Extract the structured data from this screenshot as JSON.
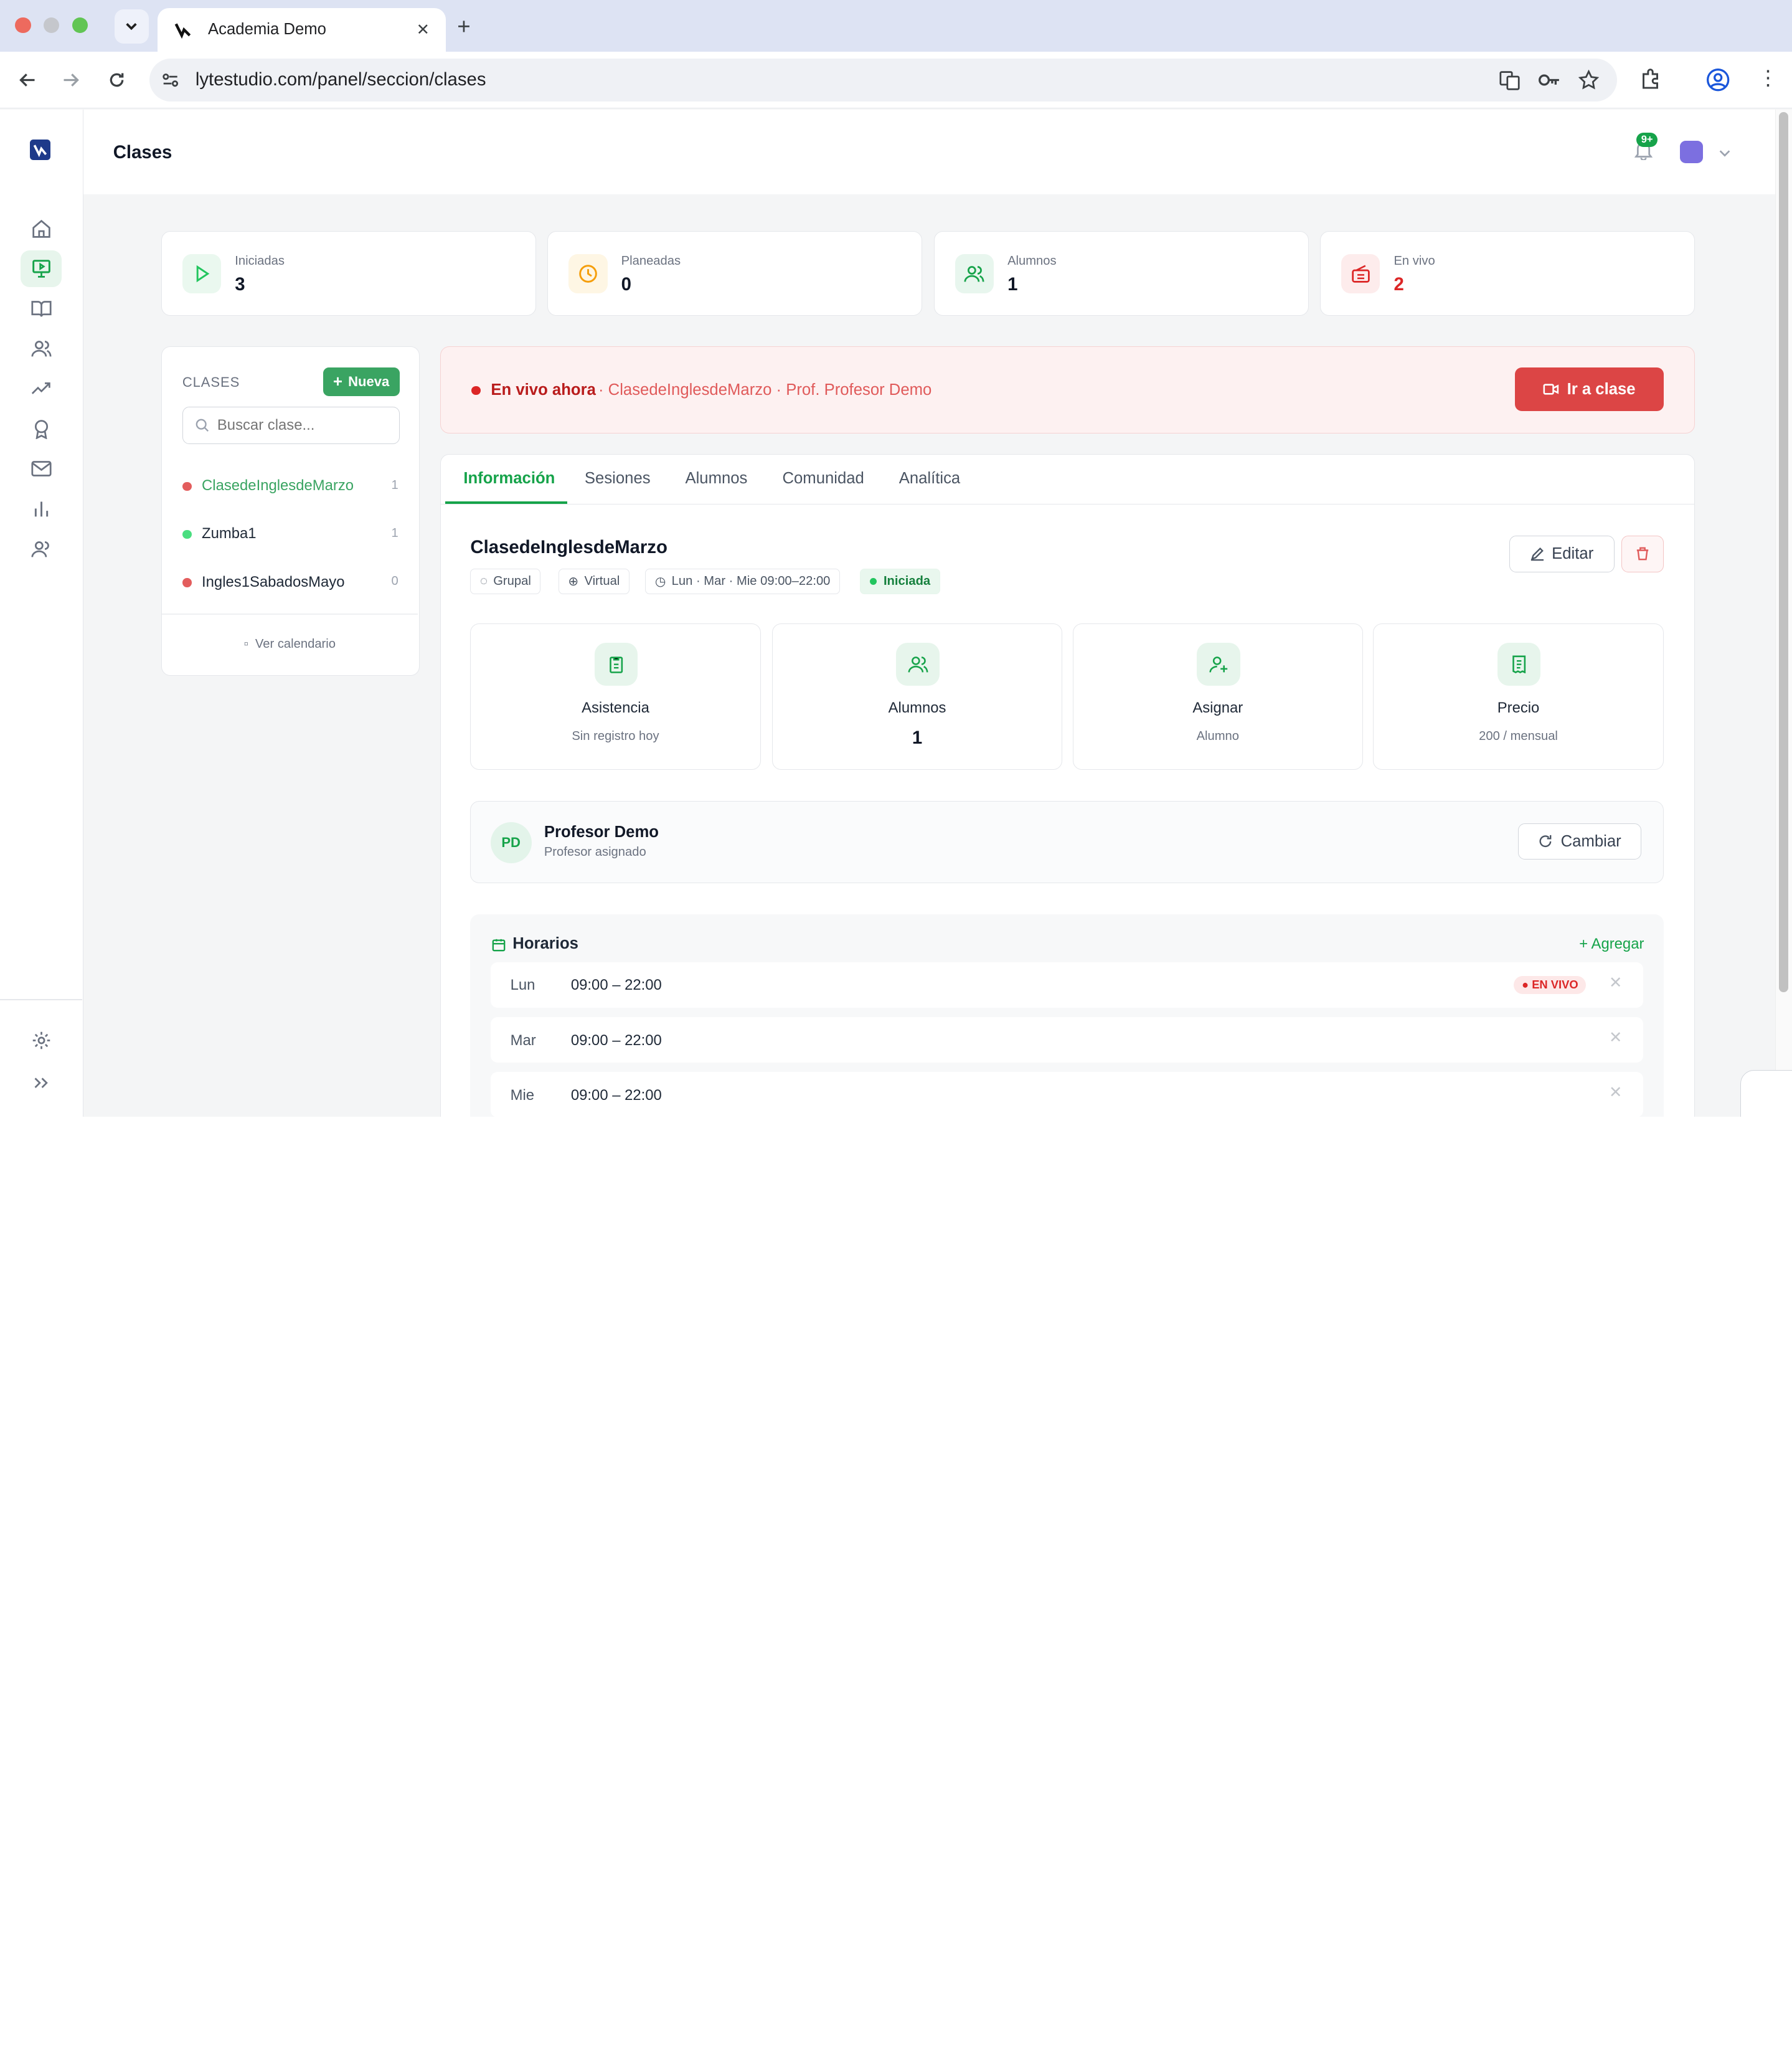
{
  "browser": {
    "tab_title": "Academia Demo",
    "url": "lytestudio.com/panel/seccion/clases"
  },
  "header": {
    "title": "Clases",
    "notif_badge": "9+"
  },
  "stats": [
    {
      "label": "Iniciadas",
      "value": "3",
      "icon": "play-icon",
      "color": "#22c55e"
    },
    {
      "label": "Planeadas",
      "value": "0",
      "icon": "clock-icon",
      "color": "#f59e0b"
    },
    {
      "label": "Alumnos",
      "value": "1",
      "icon": "users-icon",
      "color": "#16a34a"
    },
    {
      "label": "En vivo",
      "value": "2",
      "icon": "radio-icon",
      "color": "#dc2626"
    }
  ],
  "classes_panel": {
    "heading": "CLASES",
    "new_label": "Nueva",
    "search_placeholder": "Buscar clase...",
    "calendar_label": "Ver calendario",
    "items": [
      {
        "name": "ClasedeInglesdeMarzo",
        "count": "1",
        "dot": "#e35d5d"
      },
      {
        "name": "Zumba1",
        "count": "1",
        "dot": "#4ade80"
      },
      {
        "name": "Ingles1SabadosMayo",
        "count": "0",
        "dot": "#e35d5d"
      }
    ]
  },
  "live_banner": {
    "label": "En vivo ahora",
    "detail": "· ClasedeInglesdeMarzo · Prof. Profesor Demo",
    "button": "Ir a clase"
  },
  "tabs": [
    "Información",
    "Sesiones",
    "Alumnos",
    "Comunidad",
    "Analítica"
  ],
  "class_detail": {
    "title": "ClasedeInglesdeMarzo",
    "edit_label": "Editar",
    "chips": {
      "type": "Grupal",
      "mode": "Virtual",
      "schedule": "Lun · Mar · Mie 09:00–22:00",
      "status": "Iniciada"
    },
    "cards": [
      {
        "title": "Asistencia",
        "sub": "Sin registro hoy",
        "icon": "clipboard-icon"
      },
      {
        "title": "Alumnos",
        "sub": "1",
        "icon": "users-icon"
      },
      {
        "title": "Asignar",
        "sub": "Alumno",
        "icon": "user-plus-icon"
      },
      {
        "title": "Precio",
        "sub": "200 / mensual",
        "icon": "receipt-icon"
      }
    ],
    "teacher": {
      "initials": "PD",
      "name": "Profesor Demo",
      "role": "Profesor asignado",
      "change_label": "Cambiar"
    },
    "schedule": {
      "heading": "Horarios",
      "add_label": "+ Agregar",
      "live_label": "● EN VIVO",
      "rows": [
        {
          "day": "Lun",
          "time": "09:00 – 22:00"
        },
        {
          "day": "Mar",
          "time": "09:00 – 22:00"
        },
        {
          "day": "Mie",
          "time": "09:00 – 22:00"
        }
      ]
    }
  }
}
